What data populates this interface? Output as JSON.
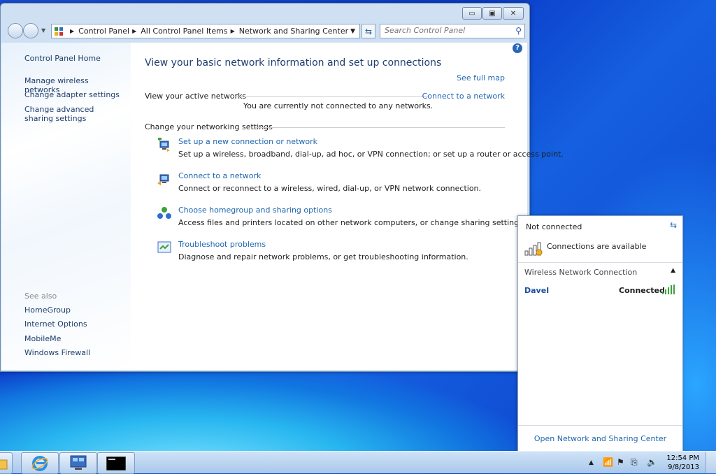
{
  "window": {
    "caption_buttons": {
      "minimize": "▭",
      "maximize": "▣",
      "close": "✕"
    }
  },
  "address": {
    "crumbs": [
      "Control Panel",
      "All Control Panel Items",
      "Network and Sharing Center"
    ],
    "search_placeholder": "Search Control Panel"
  },
  "sidebar": {
    "home": "Control Panel Home",
    "links": [
      "Manage wireless networks",
      "Change adapter settings",
      "Change advanced sharing settings"
    ],
    "see_also_label": "See also",
    "see_also": [
      "HomeGroup",
      "Internet Options",
      "MobileMe",
      "Windows Firewall"
    ]
  },
  "main": {
    "title": "View your basic network information and set up connections",
    "see_full_map": "See full map",
    "active_networks_label": "View your active networks",
    "connect_link": "Connect to a network",
    "not_connected_msg": "You are currently not connected to any networks.",
    "change_settings_label": "Change your networking settings",
    "tasks": [
      {
        "title": "Set up a new connection or network",
        "desc": "Set up a wireless, broadband, dial-up, ad hoc, or VPN connection; or set up a router or access point."
      },
      {
        "title": "Connect to a network",
        "desc": "Connect or reconnect to a wireless, wired, dial-up, or VPN network connection."
      },
      {
        "title": "Choose homegroup and sharing options",
        "desc": "Access files and printers located on other network computers, or change sharing settings."
      },
      {
        "title": "Troubleshoot problems",
        "desc": "Diagnose and repair network problems, or get troubleshooting information."
      }
    ]
  },
  "flyout": {
    "status": "Not connected",
    "available": "Connections are available",
    "section": "Wireless Network Connection",
    "network_name": "DaveI",
    "network_status": "Connected",
    "open_center": "Open Network and Sharing Center"
  },
  "taskbar": {
    "time": "12:54 PM",
    "date": "9/8/2013"
  },
  "colors": {
    "link": "#2067b0",
    "title": "#1f3f6e",
    "accent": "#2a66b8"
  }
}
